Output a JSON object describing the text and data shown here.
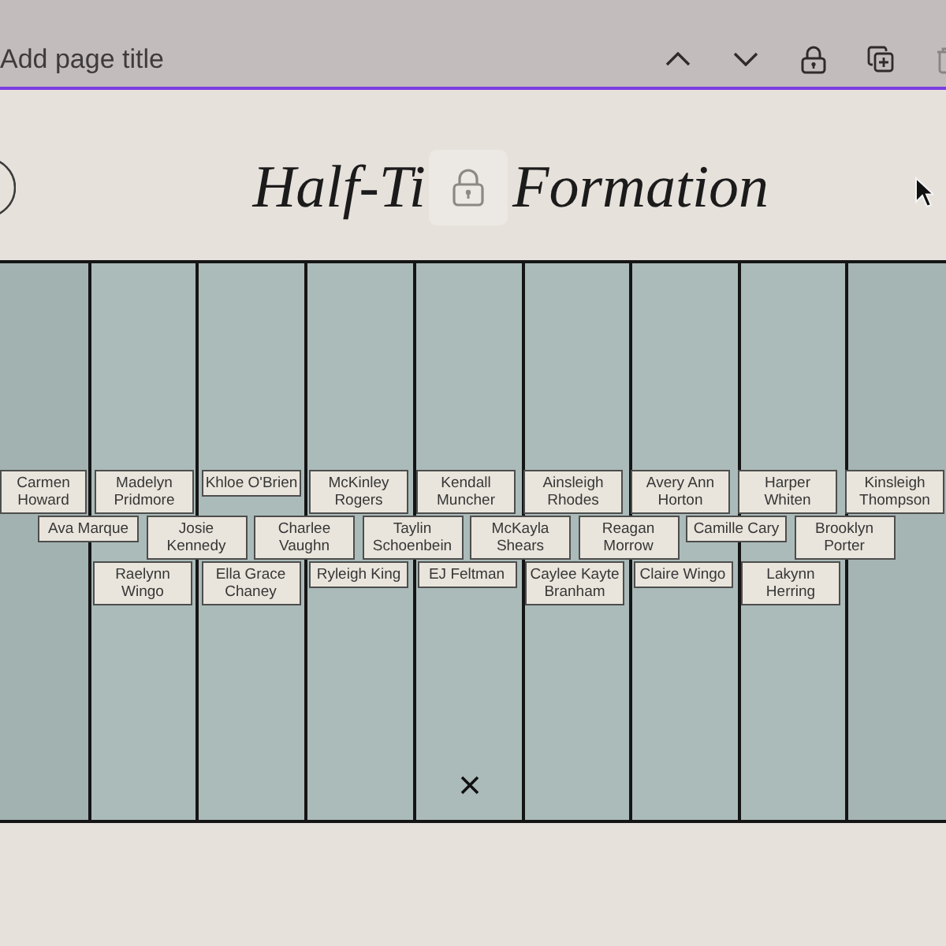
{
  "page_header": {
    "title_field": {
      "placeholder": "Add page title"
    }
  },
  "design": {
    "heading_start": "Half-Ti",
    "heading_end": "Formation",
    "formation": {
      "rows": [
        {
          "names": [
            "Carmen\nHoward",
            "Madelyn\nPridmore",
            "Khloe O'Brien",
            "McKinley\nRogers",
            "Kendall\nMuncher",
            "Ainsleigh\nRhodes",
            "Avery Ann\nHorton",
            "Harper\nWhiten",
            "Kinsleigh\nThompson"
          ]
        },
        {
          "names": [
            "Ava Marque",
            "Josie\nKennedy",
            "Charlee\nVaughn",
            "Taylin\nSchoenbein",
            "McKayla\nShears",
            "Reagan\nMorrow",
            "Camille Cary",
            "Brooklyn\nPorter"
          ]
        },
        {
          "names": [
            "Raelynn\nWingo",
            "Ella Grace\nChaney",
            "Ryleigh King",
            "EJ Feltman",
            "Caylee Kayte\nBranham",
            "Claire Wingo",
            "Lakynn\nHerring"
          ]
        }
      ]
    }
  }
}
